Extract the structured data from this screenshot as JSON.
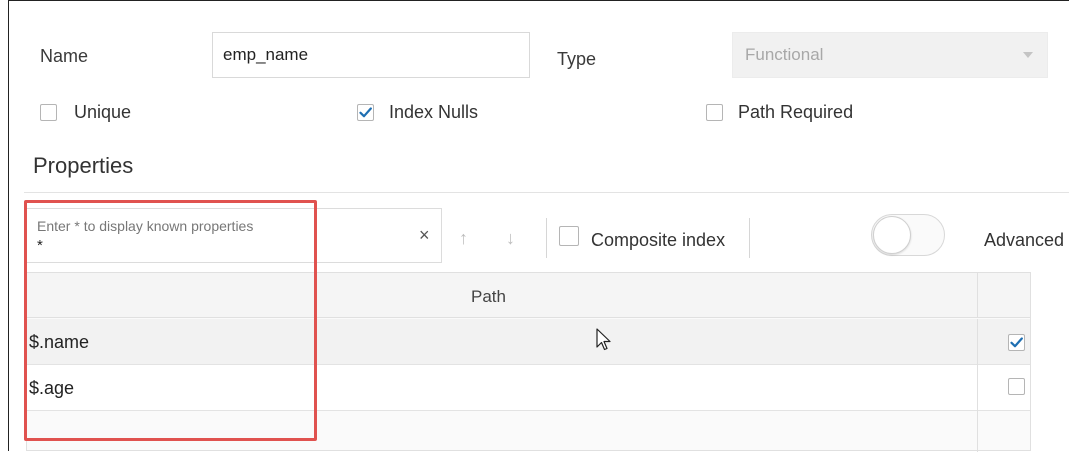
{
  "form": {
    "name_label": "Name",
    "name_value": "emp_name",
    "type_label": "Type",
    "type_value": "Functional"
  },
  "options": {
    "unique": {
      "label": "Unique",
      "checked": false
    },
    "index_nulls": {
      "label": "Index Nulls",
      "checked": true
    },
    "path_required": {
      "label": "Path Required",
      "checked": false
    }
  },
  "properties": {
    "title": "Properties",
    "filter_placeholder": "Enter * to display known properties",
    "filter_value": "*",
    "composite_label": "Composite index",
    "advanced_label": "Advanced",
    "advanced_on": false
  },
  "table": {
    "header": "Path",
    "rows": [
      {
        "path": "$.name",
        "checked": true
      },
      {
        "path": "$.age",
        "checked": false
      }
    ]
  },
  "colors": {
    "accent": "#1f6fb2",
    "highlight_border": "#e0524f"
  }
}
